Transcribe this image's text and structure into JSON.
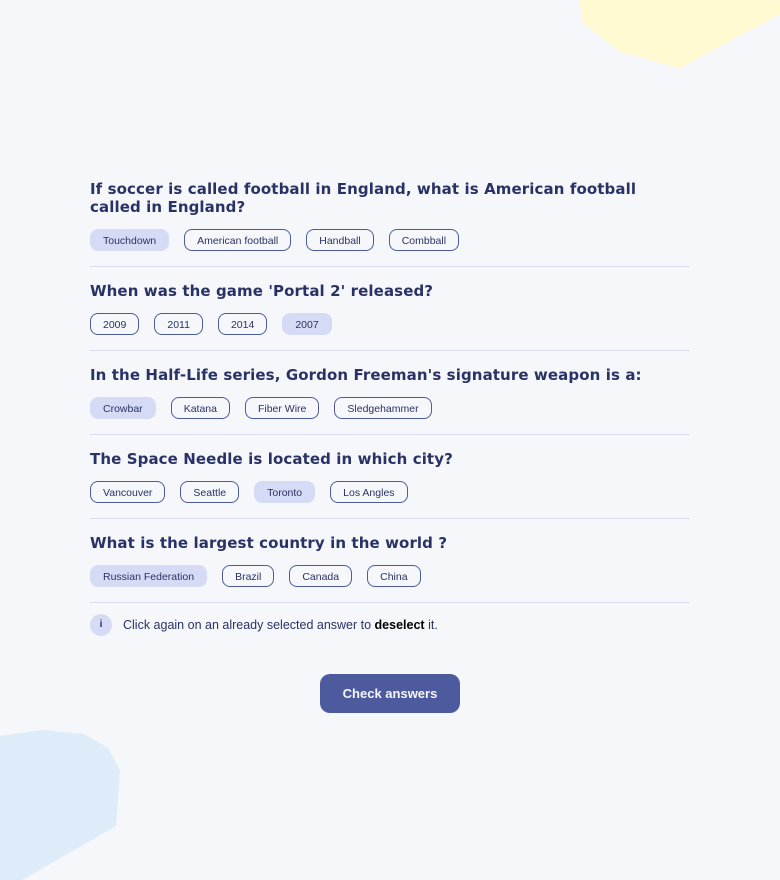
{
  "colors": {
    "background": "#f5f7fb",
    "primary": "#4d5b9e",
    "text": "#293264",
    "selected_answer": "#d6dbf5",
    "blob_yellow": "#fffad1",
    "blob_blue": "#deebf8"
  },
  "questions": [
    {
      "text": "If soccer is called football in England, what is American football called in England?",
      "answers": [
        "Touchdown",
        "American football",
        "Handball",
        "Combball"
      ],
      "selected_index": 0
    },
    {
      "text": "When was the game 'Portal 2' released?",
      "answers": [
        "2009",
        "2011",
        "2014",
        "2007"
      ],
      "selected_index": 3
    },
    {
      "text": "In the Half-Life series, Gordon Freeman's signature weapon is a:",
      "answers": [
        "Crowbar",
        "Katana",
        "Fiber Wire",
        "Sledgehammer"
      ],
      "selected_index": 0
    },
    {
      "text": "The Space Needle is located in which city?",
      "answers": [
        "Vancouver",
        "Seattle",
        "Toronto",
        "Los Angles"
      ],
      "selected_index": 2
    },
    {
      "text": "What is the largest country in the world ?",
      "answers": [
        "Russian Federation",
        "Brazil",
        "Canada",
        "China"
      ],
      "selected_index": 0
    }
  ],
  "hint": {
    "icon": "i",
    "icon_name": "info-icon",
    "text_before": "Click again on an already selected answer to",
    "text_bold": "deselect",
    "text_after": "it."
  },
  "check_button_label": "Check answers"
}
